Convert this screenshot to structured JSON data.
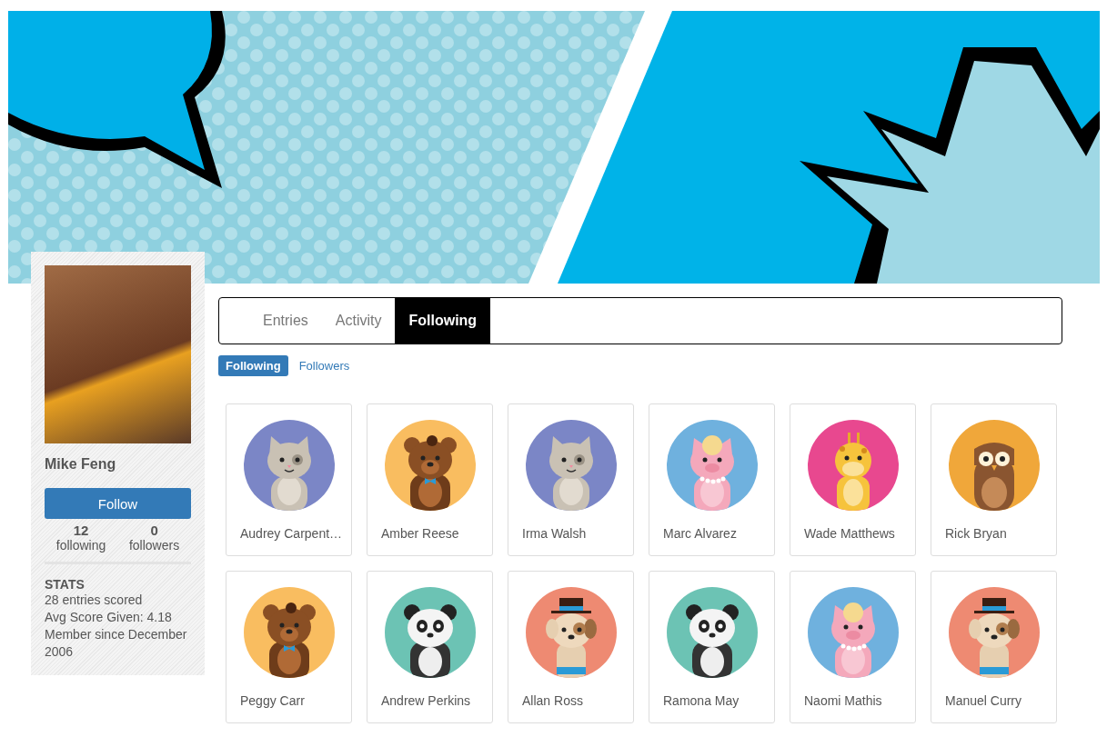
{
  "profile": {
    "name": "Mike Feng",
    "follow_button": "Follow",
    "counts": [
      {
        "value": "12",
        "label": "following"
      },
      {
        "value": "0",
        "label": "followers"
      }
    ],
    "stats_title": "STATS",
    "stats": [
      "28 entries scored",
      "Avg Score Given: 4.18",
      "Member since December 2006"
    ]
  },
  "tabs": [
    {
      "label": "Entries",
      "selected": false
    },
    {
      "label": "Activity",
      "selected": false
    },
    {
      "label": "Following",
      "selected": true
    }
  ],
  "subtabs": [
    {
      "label": "Following",
      "selected": true
    },
    {
      "label": "Followers",
      "selected": false
    }
  ],
  "people": [
    {
      "name": "Audrey Carpent…",
      "kind": "cat",
      "color": "#7b86c6"
    },
    {
      "name": "Amber Reese",
      "kind": "bear",
      "color": "#f9bd60"
    },
    {
      "name": "Irma Walsh",
      "kind": "cat",
      "color": "#7b86c6"
    },
    {
      "name": "Marc Alvarez",
      "kind": "pig",
      "color": "#6fb1de"
    },
    {
      "name": "Wade Matthews",
      "kind": "giraffe",
      "color": "#e8488f"
    },
    {
      "name": "Rick Bryan",
      "kind": "owl",
      "color": "#f0a73a"
    },
    {
      "name": "Peggy Carr",
      "kind": "bear",
      "color": "#f9bd60"
    },
    {
      "name": "Andrew Perkins",
      "kind": "panda",
      "color": "#6cc3b4"
    },
    {
      "name": "Allan Ross",
      "kind": "dog",
      "color": "#ee8a72"
    },
    {
      "name": "Ramona May",
      "kind": "panda",
      "color": "#6cc3b4"
    },
    {
      "name": "Naomi Mathis",
      "kind": "pig",
      "color": "#6fb1de"
    },
    {
      "name": "Manuel Curry",
      "kind": "dog",
      "color": "#ee8a72"
    }
  ]
}
